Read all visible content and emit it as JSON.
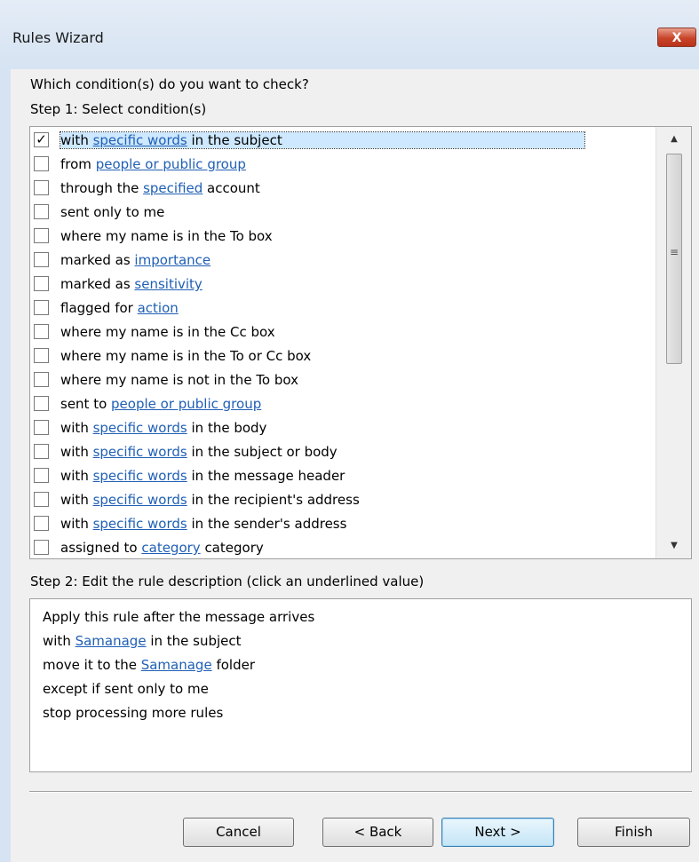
{
  "window": {
    "title": "Rules Wizard",
    "close_label": "X"
  },
  "step1": {
    "question": "Which condition(s) do you want to check?",
    "heading": "Step 1: Select condition(s)",
    "conditions": [
      {
        "checked": true,
        "pre": "with ",
        "link": "specific words",
        "post": " in the subject"
      },
      {
        "checked": false,
        "pre": "from ",
        "link": "people or public group",
        "post": ""
      },
      {
        "checked": false,
        "pre": "through the ",
        "link": "specified",
        "post": " account"
      },
      {
        "checked": false,
        "pre": "sent only to me",
        "link": "",
        "post": ""
      },
      {
        "checked": false,
        "pre": "where my name is in the To box",
        "link": "",
        "post": ""
      },
      {
        "checked": false,
        "pre": "marked as ",
        "link": "importance",
        "post": ""
      },
      {
        "checked": false,
        "pre": "marked as ",
        "link": "sensitivity",
        "post": ""
      },
      {
        "checked": false,
        "pre": "flagged for ",
        "link": "action",
        "post": ""
      },
      {
        "checked": false,
        "pre": "where my name is in the Cc box",
        "link": "",
        "post": ""
      },
      {
        "checked": false,
        "pre": "where my name is in the To or Cc box",
        "link": "",
        "post": ""
      },
      {
        "checked": false,
        "pre": "where my name is not in the To box",
        "link": "",
        "post": ""
      },
      {
        "checked": false,
        "pre": "sent to ",
        "link": "people or public group",
        "post": ""
      },
      {
        "checked": false,
        "pre": "with ",
        "link": "specific words",
        "post": " in the body"
      },
      {
        "checked": false,
        "pre": "with ",
        "link": "specific words",
        "post": " in the subject or body"
      },
      {
        "checked": false,
        "pre": "with ",
        "link": "specific words",
        "post": " in the message header"
      },
      {
        "checked": false,
        "pre": "with ",
        "link": "specific words",
        "post": " in the recipient's address"
      },
      {
        "checked": false,
        "pre": "with ",
        "link": "specific words",
        "post": " in the sender's address"
      },
      {
        "checked": false,
        "pre": "assigned to ",
        "link": "category",
        "post": " category"
      }
    ],
    "check_mark": "✓",
    "scroll_up": "▲",
    "scroll_down": "▼",
    "thumb_grip": "≡"
  },
  "step2": {
    "heading": "Step 2: Edit the rule description (click an underlined value)",
    "lines": [
      {
        "pre": "Apply this rule after the message arrives",
        "link": "",
        "post": ""
      },
      {
        "pre": "with ",
        "link": "Samanage",
        "post": " in the subject"
      },
      {
        "pre": "move it to the ",
        "link": "Samanage",
        "post": " folder"
      },
      {
        "pre": "except if sent only to me",
        "link": "",
        "post": ""
      },
      {
        "pre": "stop processing more rules",
        "link": "",
        "post": ""
      }
    ]
  },
  "buttons": {
    "cancel": "Cancel",
    "back": "< Back",
    "next": "Next >",
    "finish": "Finish"
  }
}
